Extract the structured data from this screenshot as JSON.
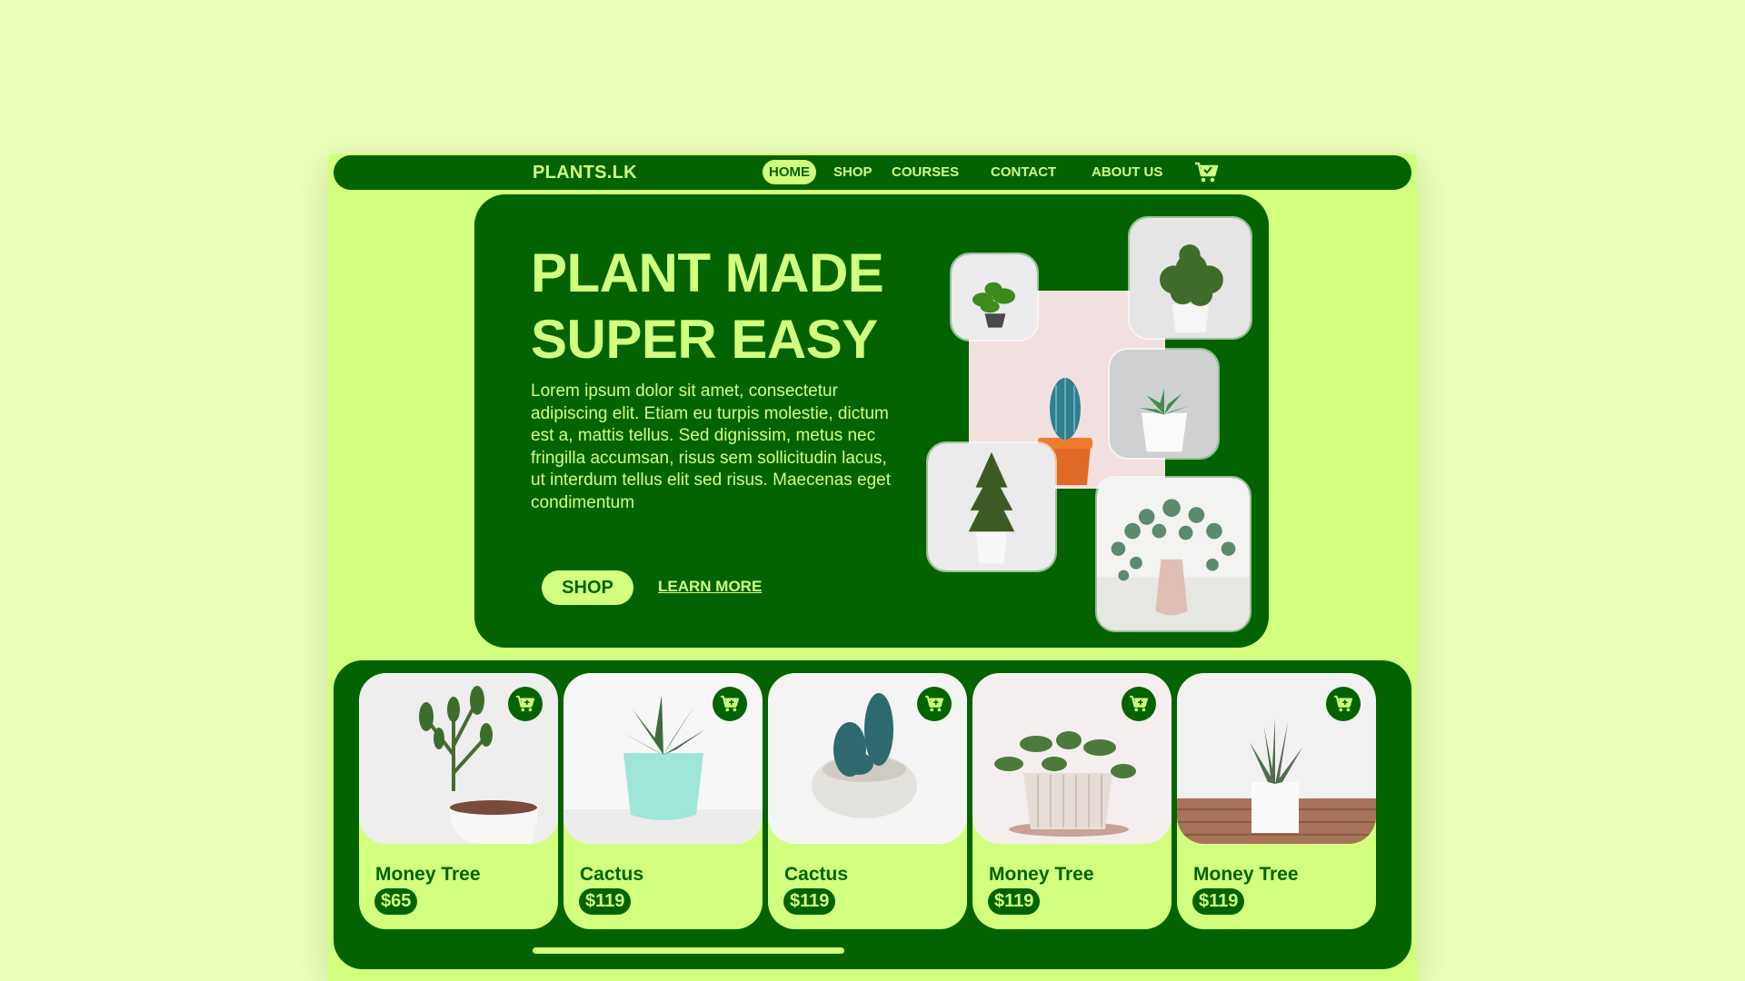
{
  "brand": {
    "logo": "PLANTS.LK"
  },
  "nav": {
    "items": [
      "HOME",
      "SHOP",
      "COURSES",
      "CONTACT",
      "ABOUT US"
    ],
    "active": "HOME",
    "cart_icon": "cart-icon"
  },
  "hero": {
    "title_line1": "PLANT MADE",
    "title_line2": "SUPER EASY",
    "text": "Lorem ipsum dolor sit amet, consectetur adipiscing elit. Etiam eu turpis molestie, dictum est a, mattis tellus. Sed dignissim, metus nec fringilla accumsan, risus sem sollicitudin lacus, ut interdum tellus elit sed risus. Maecenas eget condimentum",
    "shop_label": "SHOP",
    "learn_more_label": "LEARN MORE"
  },
  "products": [
    {
      "name": "Money Tree",
      "price": "$65"
    },
    {
      "name": "Cactus",
      "price": "$119"
    },
    {
      "name": "Cactus",
      "price": "$119"
    },
    {
      "name": "Money Tree",
      "price": "$119"
    },
    {
      "name": "Money Tree",
      "price": "$119"
    }
  ],
  "colors": {
    "page_bg": "#eaffb8",
    "accent_light": "#d2ff7e",
    "accent_dark": "#036300"
  }
}
